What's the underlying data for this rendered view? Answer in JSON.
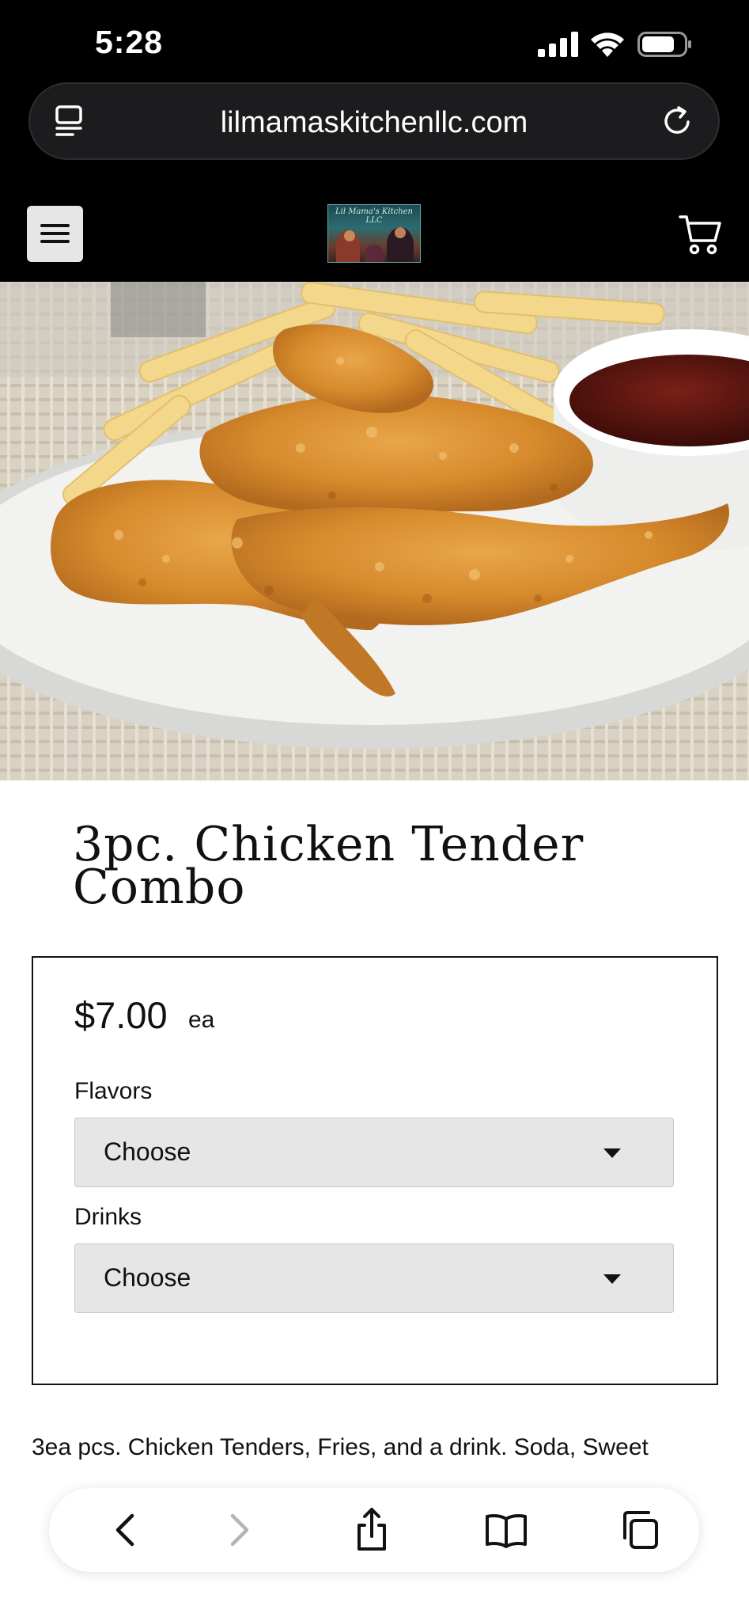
{
  "status_bar": {
    "time": "5:28"
  },
  "browser": {
    "url": "lilmamaskitchenllc.com"
  },
  "site": {
    "logo_text": "Lil Mama's Kitchen LLC"
  },
  "product": {
    "title_line1": "3pc. Chicken Tender",
    "title_line2": "Combo",
    "price": "$7.00",
    "price_unit": "ea",
    "options": [
      {
        "label": "Flavors",
        "value": "Choose"
      },
      {
        "label": "Drinks",
        "value": "Choose"
      }
    ],
    "description": "3ea pcs. Chicken Tenders, Fries, and a drink. Soda, Sweet"
  },
  "icons": {
    "status": [
      "signal-icon",
      "wifi-icon",
      "battery-icon"
    ],
    "url_bar": [
      "reader-icon",
      "reload-icon"
    ],
    "header": [
      "hamburger-menu-icon",
      "cart-icon"
    ],
    "toolbar": [
      "back-icon",
      "forward-icon",
      "share-icon",
      "bookmarks-icon",
      "tabs-icon"
    ]
  },
  "colors": {
    "header_bg": "#000000",
    "select_bg": "#e6e6e6",
    "text": "#111111"
  }
}
